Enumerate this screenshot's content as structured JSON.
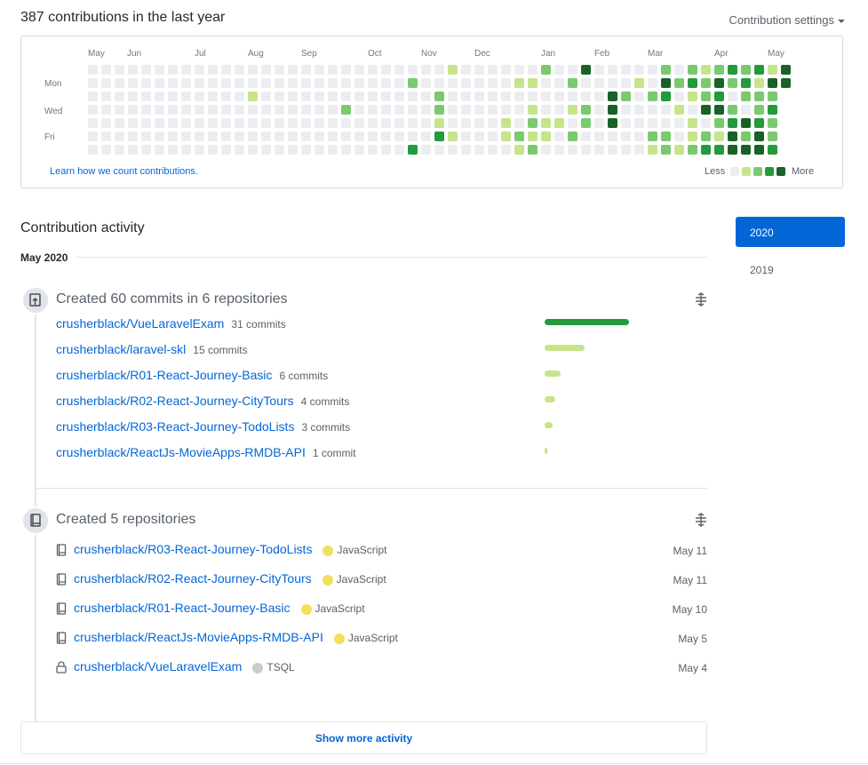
{
  "header": {
    "title": "387 contributions in the last year",
    "settings_label": "Contribution settings"
  },
  "calendar": {
    "months": [
      "May",
      "Jun",
      "Jul",
      "Aug",
      "Sep",
      "Oct",
      "Nov",
      "Dec",
      "Jan",
      "Feb",
      "Mar",
      "Apr",
      "May"
    ],
    "days": [
      "Mon",
      "Wed",
      "Fri"
    ],
    "learn_link": "Learn how we count contributions.",
    "legend_less": "Less",
    "legend_more": "More",
    "levels": [
      "#ebedf0",
      "#c6e48b",
      "#7bc96f",
      "#239a3b",
      "#196127"
    ]
  },
  "activity": {
    "heading": "Contribution activity",
    "period": "May 2020",
    "years": [
      "2020",
      "2019"
    ],
    "commits_section": {
      "title": "Created 60 commits in 6 repositories",
      "repos": [
        {
          "name": "crusherblack/VueLaravelExam",
          "count": "31 commits"
        },
        {
          "name": "crusherblack/laravel-skl",
          "count": "15 commits"
        },
        {
          "name": "crusherblack/R01-React-Journey-Basic",
          "count": "6 commits"
        },
        {
          "name": "crusherblack/R02-React-Journey-CityTours",
          "count": "4 commits"
        },
        {
          "name": "crusherblack/R03-React-Journey-TodoLists",
          "count": "3 commits"
        },
        {
          "name": "crusherblack/ReactJs-MovieApps-RMDB-API",
          "count": "1 commit"
        }
      ]
    },
    "repos_section": {
      "title": "Created 5 repositories",
      "repos": [
        {
          "name": "crusherblack/R03-React-Journey-TodoLists",
          "lang": "JavaScript",
          "lang_color": "#f1e05a",
          "date": "May 11"
        },
        {
          "name": "crusherblack/R02-React-Journey-CityTours",
          "lang": "JavaScript",
          "lang_color": "#f1e05a",
          "date": "May 11"
        },
        {
          "name": "crusherblack/R01-React-Journey-Basic",
          "lang": "JavaScript",
          "lang_color": "#f1e05a",
          "date": "May 10"
        },
        {
          "name": "crusherblack/ReactJs-MovieApps-RMDB-API",
          "lang": "JavaScript",
          "lang_color": "#f1e05a",
          "date": "May 5"
        },
        {
          "name": "crusherblack/VueLaravelExam",
          "lang": "TSQL",
          "lang_color": "#cccccc",
          "date": "May 4"
        }
      ]
    },
    "show_more": "Show more activity"
  }
}
